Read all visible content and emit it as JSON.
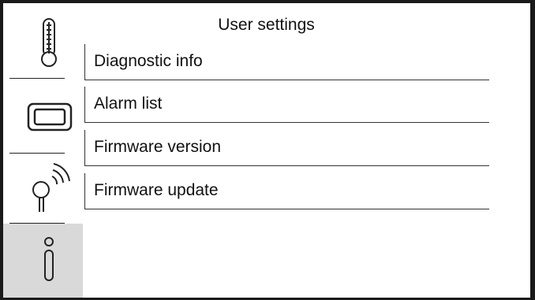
{
  "header": {
    "title": "User settings"
  },
  "rail": {
    "tabs": [
      {
        "icon": "thermometer-icon",
        "active": false
      },
      {
        "icon": "display-icon",
        "active": false
      },
      {
        "icon": "wireless-sensor-icon",
        "active": false
      },
      {
        "icon": "info-icon",
        "active": true
      }
    ]
  },
  "menu": {
    "items": [
      {
        "label": "Diagnostic info"
      },
      {
        "label": "Alarm list"
      },
      {
        "label": "Firmware version"
      },
      {
        "label": "Firmware update"
      }
    ]
  },
  "colors": {
    "active_tab": "#d9d9d9",
    "border": "#1a1a1a",
    "text": "#111111"
  }
}
